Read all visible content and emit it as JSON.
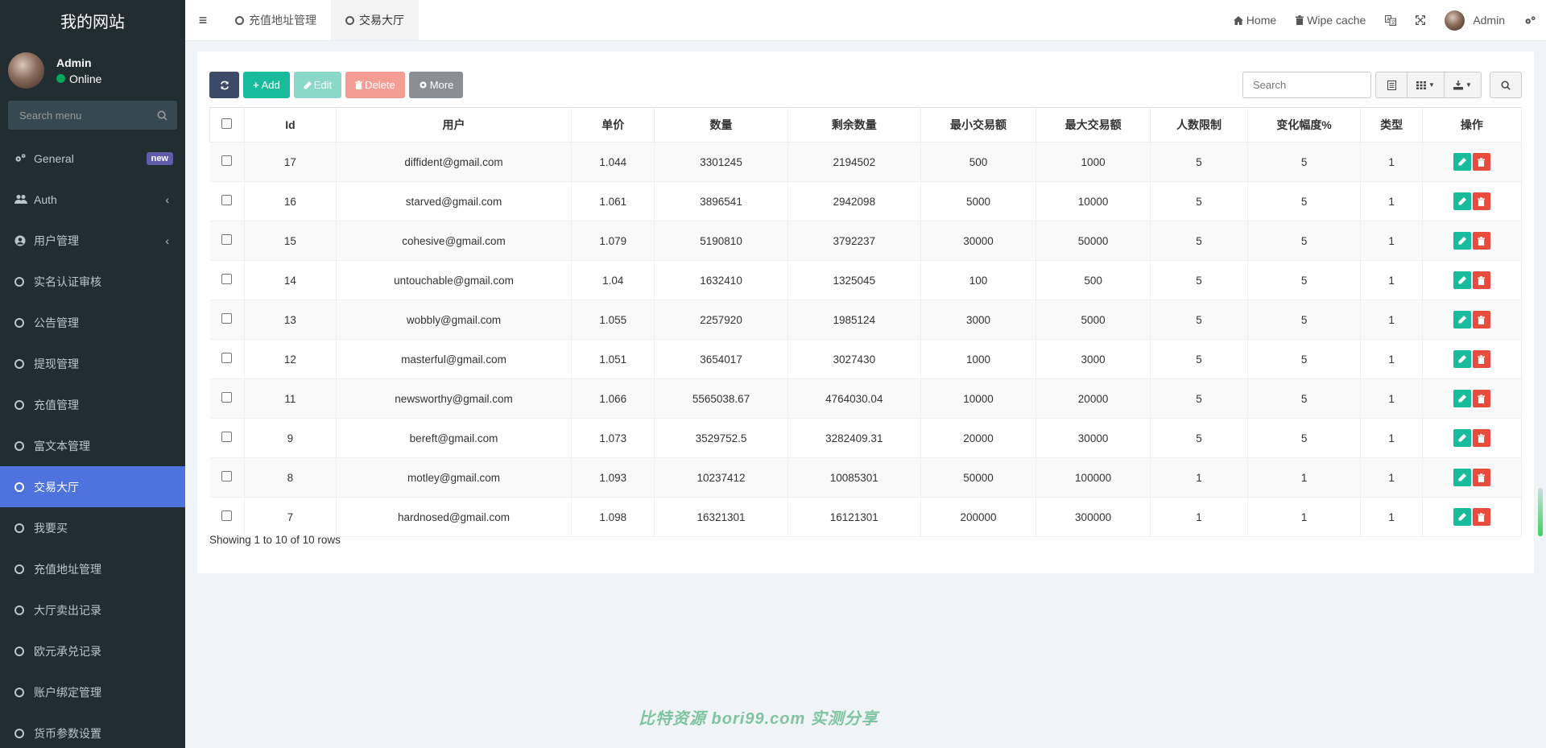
{
  "site": {
    "title": "我的网站"
  },
  "user": {
    "name": "Admin",
    "status": "Online"
  },
  "sidebar": {
    "search_placeholder": "Search menu",
    "items": [
      {
        "label": "General",
        "badge": "new"
      },
      {
        "label": "Auth"
      },
      {
        "label": "用户管理"
      },
      {
        "label": "实名认证审核"
      },
      {
        "label": "公告管理"
      },
      {
        "label": "提现管理"
      },
      {
        "label": "充值管理"
      },
      {
        "label": "富文本管理"
      },
      {
        "label": "交易大厅"
      },
      {
        "label": "我要买"
      },
      {
        "label": "充值地址管理"
      },
      {
        "label": "大厅卖出记录"
      },
      {
        "label": "欧元承兑记录"
      },
      {
        "label": "账户绑定管理"
      },
      {
        "label": "货币参数设置"
      }
    ],
    "active_item": "交易大厅"
  },
  "header": {
    "tabs": [
      {
        "label": "充值地址管理"
      },
      {
        "label": "交易大厅"
      }
    ],
    "home_label": "Home",
    "wipe_cache_label": "Wipe cache",
    "admin_label": "Admin"
  },
  "toolbar": {
    "add_label": "Add",
    "edit_label": "Edit",
    "delete_label": "Delete",
    "more_label": "More",
    "search_placeholder": "Search"
  },
  "table": {
    "columns": [
      "Id",
      "用户",
      "单价",
      "数量",
      "剩余数量",
      "最小交易额",
      "最大交易额",
      "人数限制",
      "变化幅度%",
      "类型",
      "操作"
    ],
    "rows": [
      [
        "17",
        "diffident@gmail.com",
        "1.044",
        "3301245",
        "2194502",
        "500",
        "1000",
        "5",
        "5",
        "1"
      ],
      [
        "16",
        "starved@gmail.com",
        "1.061",
        "3896541",
        "2942098",
        "5000",
        "10000",
        "5",
        "5",
        "1"
      ],
      [
        "15",
        "cohesive@gmail.com",
        "1.079",
        "5190810",
        "3792237",
        "30000",
        "50000",
        "5",
        "5",
        "1"
      ],
      [
        "14",
        "untouchable@gmail.com",
        "1.04",
        "1632410",
        "1325045",
        "100",
        "500",
        "5",
        "5",
        "1"
      ],
      [
        "13",
        "wobbly@gmail.com",
        "1.055",
        "2257920",
        "1985124",
        "3000",
        "5000",
        "5",
        "5",
        "1"
      ],
      [
        "12",
        "masterful@gmail.com",
        "1.051",
        "3654017",
        "3027430",
        "1000",
        "3000",
        "5",
        "5",
        "1"
      ],
      [
        "11",
        "newsworthy@gmail.com",
        "1.066",
        "5565038.67",
        "4764030.04",
        "10000",
        "20000",
        "5",
        "5",
        "1"
      ],
      [
        "9",
        "bereft@gmail.com",
        "1.073",
        "3529752.5",
        "3282409.31",
        "20000",
        "30000",
        "5",
        "5",
        "1"
      ],
      [
        "8",
        "motley@gmail.com",
        "1.093",
        "10237412",
        "10085301",
        "50000",
        "100000",
        "1",
        "1",
        "1"
      ],
      [
        "7",
        "hardnosed@gmail.com",
        "1.098",
        "16321301",
        "16121301",
        "200000",
        "300000",
        "1",
        "1",
        "1"
      ]
    ]
  },
  "pagination": {
    "info": "Showing 1 to 10 of 10 rows"
  },
  "watermark": "比特资源 bori99.com 实测分享"
}
